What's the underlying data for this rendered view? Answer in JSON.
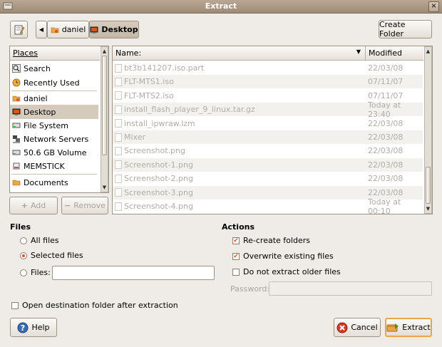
{
  "window": {
    "title": "Extract"
  },
  "toolbar": {
    "path": [
      "daniel",
      "Desktop"
    ],
    "create_folder": "Create Folder"
  },
  "places": {
    "header": "Places",
    "items": [
      {
        "label": "Search",
        "icon": "search-icon"
      },
      {
        "label": "Recently Used",
        "icon": "clock-icon"
      },
      {
        "label": "daniel",
        "icon": "home-folder-icon"
      },
      {
        "label": "Desktop",
        "icon": "desktop-icon",
        "selected": true
      },
      {
        "label": "File System",
        "icon": "drive-icon"
      },
      {
        "label": "Network Servers",
        "icon": "network-icon"
      },
      {
        "label": "50.6 GB Volume",
        "icon": "drive-icon"
      },
      {
        "label": "MEMSTICK",
        "icon": "usb-icon"
      },
      {
        "label": "Documents",
        "icon": "folder-icon"
      }
    ],
    "add": "Add",
    "remove": "Remove"
  },
  "files": {
    "col_name": "Name:",
    "col_modified": "Modified",
    "rows": [
      {
        "name": "bt3b141207.iso.part",
        "modified": "22/03/08"
      },
      {
        "name": "FLT-MTS1.iso",
        "modified": "07/11/07"
      },
      {
        "name": "FLT-MTS2.iso",
        "modified": "07/11/07"
      },
      {
        "name": "install_flash_player_9_linux.tar.gz",
        "modified": "Today at 23:40"
      },
      {
        "name": "install_ipwraw.lzm",
        "modified": "22/03/08"
      },
      {
        "name": "Mixer",
        "modified": "22/03/08"
      },
      {
        "name": "Screenshot.png",
        "modified": "22/03/08"
      },
      {
        "name": "Screenshot-1.png",
        "modified": "22/03/08"
      },
      {
        "name": "Screenshot-2.png",
        "modified": "22/03/08"
      },
      {
        "name": "Screenshot-3.png",
        "modified": "22/03/08"
      },
      {
        "name": "Screenshot-4.png",
        "modified": "Today at 00:10"
      }
    ]
  },
  "files_section": {
    "title": "Files",
    "all": "All files",
    "selected": "Selected files",
    "files_label": "Files:",
    "files_value": "",
    "selected_option": "selected"
  },
  "actions": {
    "title": "Actions",
    "recreate": "Re-create folders",
    "recreate_checked": true,
    "overwrite": "Overwrite existing files",
    "overwrite_checked": true,
    "no_older": "Do not extract older files",
    "no_older_checked": false,
    "password_label": "Password:",
    "password_value": ""
  },
  "open_dest": "Open destination folder after extraction",
  "buttons": {
    "help": "Help",
    "cancel": "Cancel",
    "extract": "Extract"
  },
  "colors": {
    "accent": "#d9541e",
    "titlebar": "#a89580",
    "selection": "#d5cbbd"
  }
}
